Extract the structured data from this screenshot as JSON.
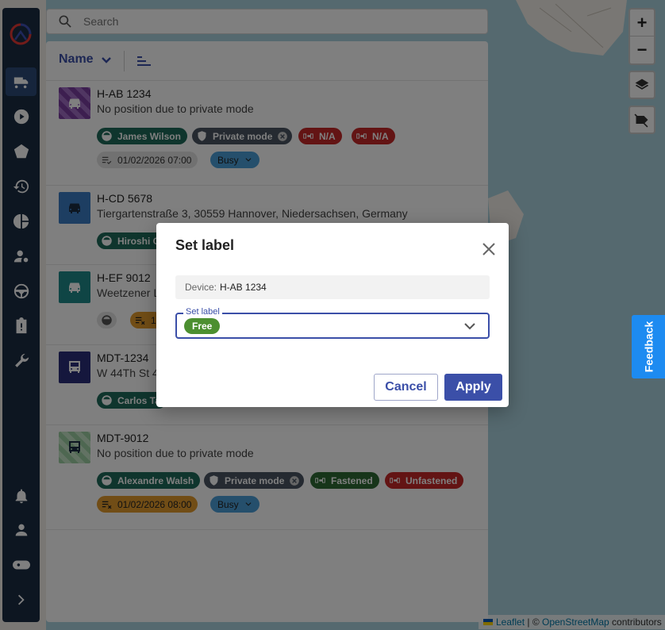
{
  "search": {
    "placeholder": "Search"
  },
  "list_header": {
    "sort_label": "Name"
  },
  "vehicles": [
    {
      "name": "H-AB 1234",
      "address": "No position due to private mode",
      "chips": [
        "James Wilson",
        "Private mode",
        "N/A",
        "N/A"
      ],
      "timestamp": "01/02/2026 07:00",
      "status": "Busy"
    },
    {
      "name": "H-CD 5678",
      "address": "Tiergartenstraße 3, 30559 Hannover, Niedersachsen, Germany",
      "chips": [
        "Hiroshi G"
      ]
    },
    {
      "name": "H-EF 9012",
      "address": "Weetzener L",
      "chips": [
        "1"
      ]
    },
    {
      "name": "MDT-1234",
      "address": "W 44Th St 4",
      "chips": [
        "Carlos Ta"
      ]
    },
    {
      "name": "MDT-9012",
      "address": "No position due to private mode",
      "chips": [
        "Alexandre Walsh",
        "Private mode",
        "Fastened",
        "Unfastened"
      ],
      "timestamp": "01/02/2026 08:00",
      "status": "Busy"
    }
  ],
  "dialog": {
    "title": "Set label",
    "device_label": "Device:",
    "device_value": "H-AB 1234",
    "field_label": "Set label",
    "selected_value": "Free",
    "cancel_label": "Cancel",
    "apply_label": "Apply"
  },
  "map": {
    "zoom_in": "+",
    "zoom_out": "−",
    "feedback_label": "Feedback",
    "attribution": {
      "leaflet": "Leaflet",
      "sep": " | © ",
      "osm": "OpenStreetMap",
      "contributors": " contributors"
    }
  },
  "colors": {
    "sidebar": "#1b2c42",
    "accent": "#3b4fa8",
    "driver_chip": "#1f6b5a",
    "alert_chip": "#c62828",
    "label_free": "#4c8f30",
    "feedback": "#1d8bf1"
  }
}
